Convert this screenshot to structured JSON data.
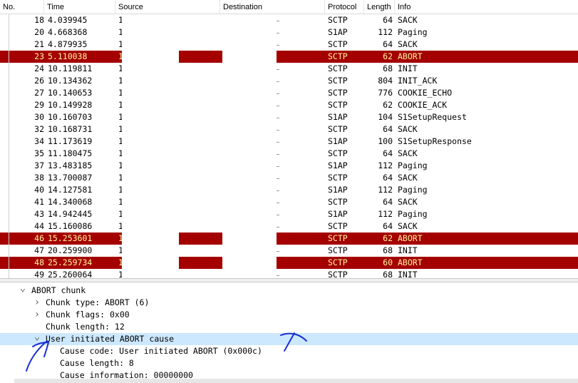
{
  "columns": {
    "no": "No.",
    "time": "Time",
    "source": "Source",
    "destination": "Destination",
    "protocol": "Protocol",
    "length": "Length",
    "info": "Info"
  },
  "packets": [
    {
      "no": "18",
      "time": "4.039945",
      "src": "1",
      "proto": "SCTP",
      "len": "64",
      "info": "SACK",
      "abort": false
    },
    {
      "no": "20",
      "time": "4.668368",
      "src": "1",
      "proto": "S1AP",
      "len": "112",
      "info": "Paging",
      "abort": false
    },
    {
      "no": "21",
      "time": "4.879935",
      "src": "1",
      "proto": "SCTP",
      "len": "64",
      "info": "SACK",
      "abort": false
    },
    {
      "no": "23",
      "time": "5.110038",
      "src": "1",
      "proto": "SCTP",
      "len": "62",
      "info": "ABORT",
      "abort": true
    },
    {
      "no": "24",
      "time": "10.119811",
      "src": "1",
      "proto": "SCTP",
      "len": "68",
      "info": "INIT",
      "abort": false
    },
    {
      "no": "26",
      "time": "10.134362",
      "src": "1",
      "proto": "SCTP",
      "len": "804",
      "info": "INIT_ACK",
      "abort": false
    },
    {
      "no": "27",
      "time": "10.140653",
      "src": "1",
      "proto": "SCTP",
      "len": "776",
      "info": "COOKIE_ECHO",
      "abort": false
    },
    {
      "no": "29",
      "time": "10.149928",
      "src": "1",
      "proto": "SCTP",
      "len": "62",
      "info": "COOKIE_ACK",
      "abort": false
    },
    {
      "no": "30",
      "time": "10.160703",
      "src": "1",
      "proto": "S1AP",
      "len": "104",
      "info": "S1SetupRequest",
      "abort": false
    },
    {
      "no": "32",
      "time": "10.168731",
      "src": "1",
      "proto": "SCTP",
      "len": "64",
      "info": "SACK",
      "abort": false
    },
    {
      "no": "34",
      "time": "11.173619",
      "src": "1",
      "proto": "S1AP",
      "len": "100",
      "info": "S1SetupResponse",
      "abort": false
    },
    {
      "no": "35",
      "time": "11.180475",
      "src": "1",
      "proto": "SCTP",
      "len": "64",
      "info": "SACK",
      "abort": false
    },
    {
      "no": "37",
      "time": "13.483185",
      "src": "1",
      "proto": "S1AP",
      "len": "112",
      "info": "Paging",
      "abort": false
    },
    {
      "no": "38",
      "time": "13.700087",
      "src": "1",
      "proto": "SCTP",
      "len": "64",
      "info": "SACK",
      "abort": false
    },
    {
      "no": "40",
      "time": "14.127581",
      "src": "1",
      "proto": "S1AP",
      "len": "112",
      "info": "Paging",
      "abort": false
    },
    {
      "no": "41",
      "time": "14.340068",
      "src": "1",
      "proto": "SCTP",
      "len": "64",
      "info": "SACK",
      "abort": false
    },
    {
      "no": "43",
      "time": "14.942445",
      "src": "1",
      "proto": "S1AP",
      "len": "112",
      "info": "Paging",
      "abort": false
    },
    {
      "no": "44",
      "time": "15.160086",
      "src": "1",
      "proto": "SCTP",
      "len": "64",
      "info": "SACK",
      "abort": false
    },
    {
      "no": "46",
      "time": "15.253601",
      "src": "1",
      "proto": "SCTP",
      "len": "62",
      "info": "ABORT",
      "abort": true
    },
    {
      "no": "47",
      "time": "20.259900",
      "src": "1",
      "proto": "SCTP",
      "len": "68",
      "info": "INIT",
      "abort": false
    },
    {
      "no": "48",
      "time": "25.259734",
      "src": "1",
      "proto": "SCTP",
      "len": "60",
      "info": "ABORT",
      "abort": true
    },
    {
      "no": "49",
      "time": "25.260064",
      "src": "1",
      "proto": "SCTP",
      "len": "68",
      "info": "INIT",
      "abort": false
    }
  ],
  "details": [
    {
      "text": "ABORT chunk",
      "arrow": "expanded",
      "indent": 1,
      "highlight": false
    },
    {
      "text": "Chunk type: ABORT (6)",
      "arrow": "collapsed",
      "indent": 2,
      "highlight": false
    },
    {
      "text": "Chunk flags: 0x00",
      "arrow": "collapsed",
      "indent": 2,
      "highlight": false
    },
    {
      "text": "Chunk length: 12",
      "arrow": "none",
      "indent": 2,
      "highlight": false
    },
    {
      "text": "User initiated ABORT cause",
      "arrow": "expanded",
      "indent": 2,
      "highlight": true
    },
    {
      "text": "Cause code: User initiated ABORT (0x000c)",
      "arrow": "none",
      "indent": 3,
      "highlight": false
    },
    {
      "text": "Cause length: 8",
      "arrow": "none",
      "indent": 3,
      "highlight": false
    },
    {
      "text": "Cause information: 00000000",
      "arrow": "none",
      "indent": 3,
      "highlight": false
    }
  ],
  "colors": {
    "abort_row_bg": "#a40000",
    "abort_row_fg": "#fff6a0",
    "selected_detail_bg": "#cce8ff",
    "annotation_ink": "#1a2fd4"
  },
  "icons": {
    "expanded": "chevron-down-icon",
    "collapsed": "chevron-right-icon"
  }
}
